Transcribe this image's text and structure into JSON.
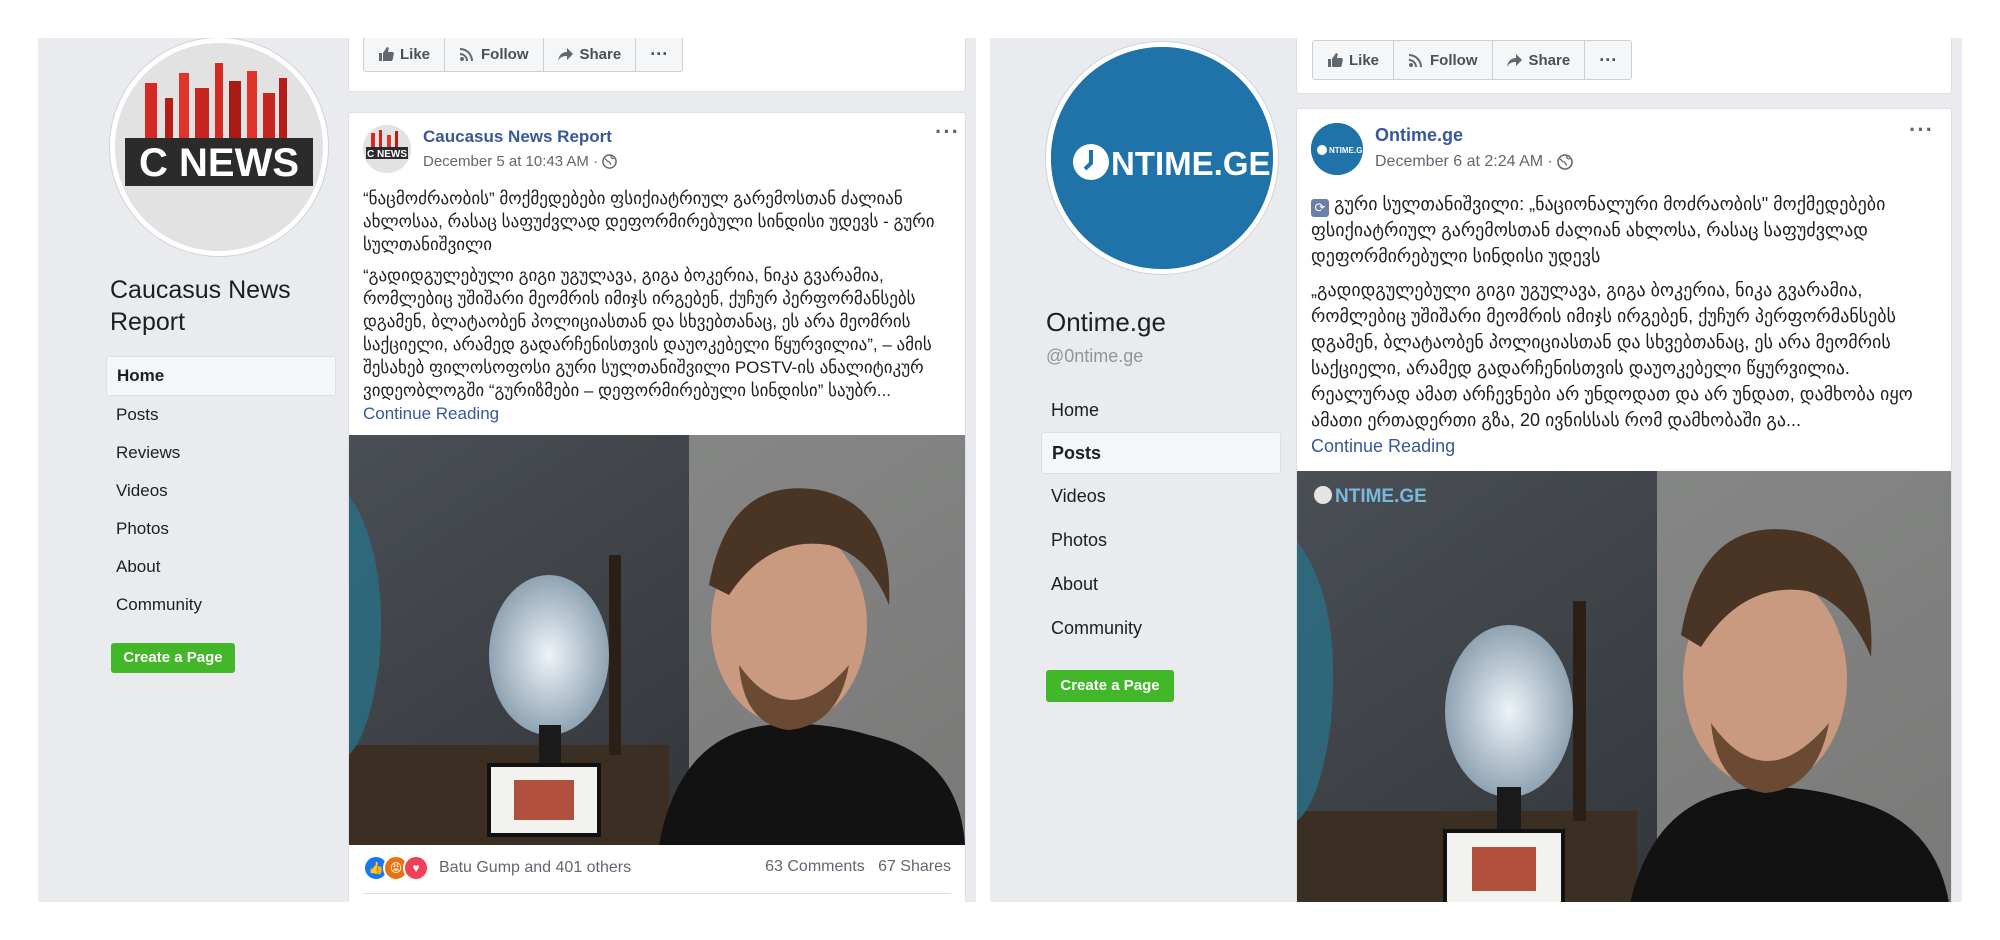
{
  "left": {
    "page_name": "Caucasus News Report",
    "logo_text": "C NEWS",
    "nav": [
      "Home",
      "Posts",
      "Reviews",
      "Videos",
      "Photos",
      "About",
      "Community"
    ],
    "create_page": "Create a Page",
    "actions": {
      "like": "Like",
      "follow": "Follow",
      "share": "Share"
    },
    "post": {
      "author": "Caucasus News Report",
      "date": "December 5 at 10:43 AM ·",
      "headline": "“ნაცმოძრაობის” მოქმედებები ფსიქიატრიულ გარემოსთან ძალიან ახლოსაა, რასაც საფუძვლად დეფორმირებული სინდისი უდევს - გური სულთანიშვილი",
      "body": "“გადიდგულებული გიგი უგულავა, გიგა ბოკერია, ნიკა გვარამია, რომლებიც უშიშარი მეომრის იმიჯს ირგებენ, ქუჩურ პერფორმანსებს დგამენ, ბლატაობენ პოლიციასთან და სხვებთანაც, ეს არა მეომრის საქციელი, არამედ გადარჩენისთვის დაუოკებელი წყურვილია”, – ამის შესახებ ფილოსოფოსი გური სულთანიშვილი POSTV-ის ანალიტიკურ ვიდეობლოგში “გურიზმები – დეფორმირებული სინდისი” საუბრ...",
      "continue": "Continue Reading",
      "reactions_text": "Batu Gump and 401 others",
      "comments": "63 Comments",
      "shares": "67 Shares"
    }
  },
  "right": {
    "page_name": "Ontime.ge",
    "handle": "@0ntime.ge",
    "logo_text": "NTIME.GE",
    "watermark": "NTIME.GE",
    "nav": [
      "Home",
      "Posts",
      "Videos",
      "Photos",
      "About",
      "Community"
    ],
    "create_page": "Create a Page",
    "actions": {
      "like": "Like",
      "follow": "Follow",
      "share": "Share"
    },
    "post": {
      "author": "Ontime.ge",
      "date": "December 6 at 2:24 AM ·",
      "headline": "გური სულთანიშვილი: „ნაციონალური მოძრაობის\" მოქმედებები ფსიქიატრიულ გარემოსთან ძალიან ახლოსა, რასაც საფუძვლად დეფორმირებული სინდისი უდევს",
      "body": "„გადიდგულებული გიგი უგულავა, გიგა ბოკერია, ნიკა გვარამია, რომლებიც უშიშარი მეომრის იმიჯს ირგებენ, ქუჩურ პერფორმანსებს დგამენ, ბლატაობენ პოლიციასთან და სხვებთანაც, ეს არა მეომრის საქციელი, არამედ გადარჩენისთვის დაუოკებელი წყურვილია. რეალურად ამათ არჩევნები არ უნდოდათ და არ უნდათ, დამხობა იყო ამათი ერთადერთი გზა, 20 ივნისსას რომ დამხობაში გა...",
      "continue": "Continue Reading"
    }
  },
  "colors": {
    "panel_bg": "#e9ebee",
    "link": "#385898",
    "green": "#42b72a",
    "ontime_blue": "#1f73a8"
  }
}
